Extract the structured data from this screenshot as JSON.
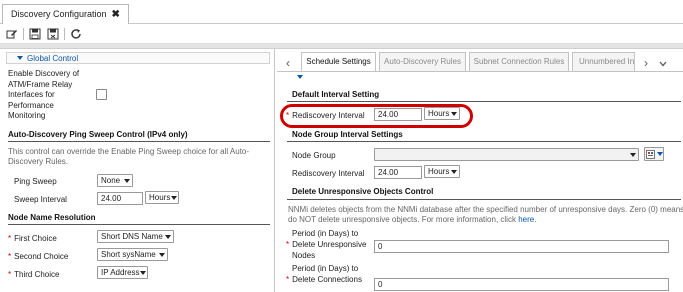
{
  "window": {
    "tab_title": "Discovery Configuration",
    "tab_close_glyph": "✖"
  },
  "toolbar": {
    "icons": [
      "edit-icon",
      "save-icon",
      "save-close-icon",
      "refresh-icon"
    ]
  },
  "left_panel": {
    "global_control": {
      "title": "Global Control",
      "atm_label": [
        "Enable Discovery of",
        "ATM/Frame Relay",
        "Interfaces for",
        "Performance",
        "Monitoring"
      ],
      "atm_checked": false
    },
    "ping_sweep_section": {
      "title": "Auto-Discovery Ping Sweep Control (IPv4 only)",
      "help": [
        "This control can override the Enable Ping Sweep choice for all Auto-",
        "Discovery Rules."
      ],
      "ping_sweep_label": "Ping Sweep",
      "ping_sweep_value": "None",
      "sweep_interval_label": "Sweep Interval",
      "sweep_interval_value": "24.00",
      "sweep_interval_unit": "Hours"
    },
    "name_resolution": {
      "title": "Node Name Resolution",
      "first_choice_label": "First Choice",
      "first_choice_value": "Short DNS Name",
      "second_choice_label": "Second Choice",
      "second_choice_value": "Short sysName",
      "third_choice_label": "Third Choice",
      "third_choice_value": "IP Address"
    }
  },
  "right_panel": {
    "tabs": [
      {
        "label": "Schedule Settings",
        "active": true
      },
      {
        "label": "Auto-Discovery Rules",
        "active": false
      },
      {
        "label": "Subnet Connection Rules",
        "active": false
      },
      {
        "label": "Unnumbered In",
        "active": false
      }
    ],
    "default_interval": {
      "title": "Default Interval Setting",
      "rediscovery_label": "Rediscovery Interval",
      "rediscovery_value": "24.00",
      "rediscovery_unit": "Hours"
    },
    "node_group_interval": {
      "title": "Node Group Interval Settings",
      "node_group_label": "Node Group",
      "node_group_value": "",
      "rediscovery_label": "Rediscovery Interval",
      "rediscovery_value": "24.00",
      "rediscovery_unit": "Hours"
    },
    "delete_unresponsive": {
      "title": "Delete Unresponsive Objects Control",
      "help_line1": "NNMi deletes objects from the NNMi database after the specified number of unresponsive days. Zero (0) means",
      "help_line2_prefix": "do NOT delete unresponsive objects. For more information, click ",
      "help_link": "here",
      "help_line2_suffix": ".",
      "nodes_label": [
        "Period (in Days) to",
        "Delete Unresponsive",
        "Nodes"
      ],
      "nodes_value": "0",
      "connections_label": [
        "Period (in Days) to",
        "Delete Connections"
      ],
      "connections_value": "0"
    }
  },
  "colors": {
    "accent": "#0a57a6",
    "required": "#cc0000",
    "highlight": "#d00000"
  }
}
